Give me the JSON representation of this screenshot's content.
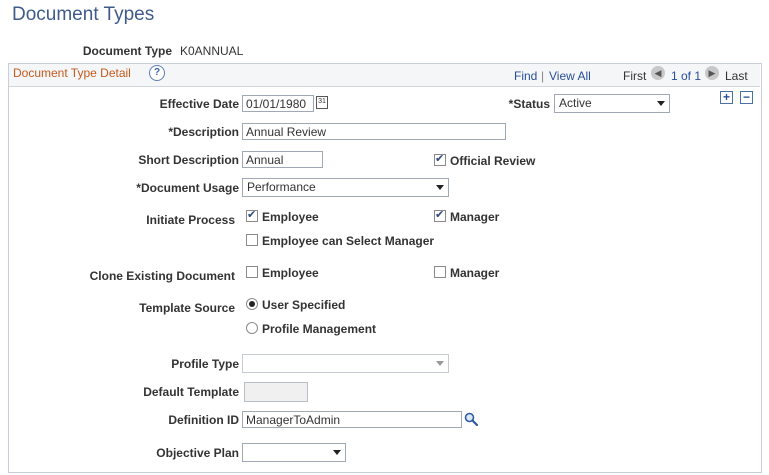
{
  "page": {
    "title": "Document Types"
  },
  "document_type": {
    "label": "Document Type",
    "value": "K0ANNUAL"
  },
  "panel": {
    "title": "Document Type Detail",
    "help_icon": "help-icon",
    "nav": {
      "find": "Find",
      "separator": "|",
      "view_all": "View All",
      "first": "First",
      "range": "1 of 1",
      "last": "Last"
    }
  },
  "form": {
    "effective_date": {
      "label": "Effective Date",
      "value": "01/01/1980",
      "icon": "calendar-icon"
    },
    "status": {
      "label": "*Status",
      "value": "Active"
    },
    "description": {
      "label": "*Description",
      "value": "Annual Review"
    },
    "short_description": {
      "label": "Short Description",
      "value": "Annual"
    },
    "official_review": {
      "label": "Official Review",
      "checked": true
    },
    "document_usage": {
      "label": "*Document Usage",
      "value": "Performance"
    },
    "initiate_process": {
      "label": "Initiate Process",
      "employee": {
        "label": "Employee",
        "checked": true
      },
      "manager": {
        "label": "Manager",
        "checked": true
      },
      "employee_select_manager": {
        "label": "Employee can Select Manager",
        "checked": false
      }
    },
    "clone_existing": {
      "label": "Clone Existing Document",
      "employee": {
        "label": "Employee",
        "checked": false
      },
      "manager": {
        "label": "Manager",
        "checked": false
      }
    },
    "template_source": {
      "label": "Template Source",
      "user_specified": {
        "label": "User Specified",
        "selected": true
      },
      "profile_management": {
        "label": "Profile Management",
        "selected": false
      }
    },
    "profile_type": {
      "label": "Profile Type",
      "value": ""
    },
    "default_template": {
      "label": "Default Template",
      "value": ""
    },
    "definition_id": {
      "label": "Definition ID",
      "value": "ManagerToAdmin",
      "icon": "lookup-icon"
    },
    "objective_plan": {
      "label": "Objective Plan",
      "value": ""
    }
  },
  "row_actions": {
    "add": "+",
    "remove": "−"
  }
}
